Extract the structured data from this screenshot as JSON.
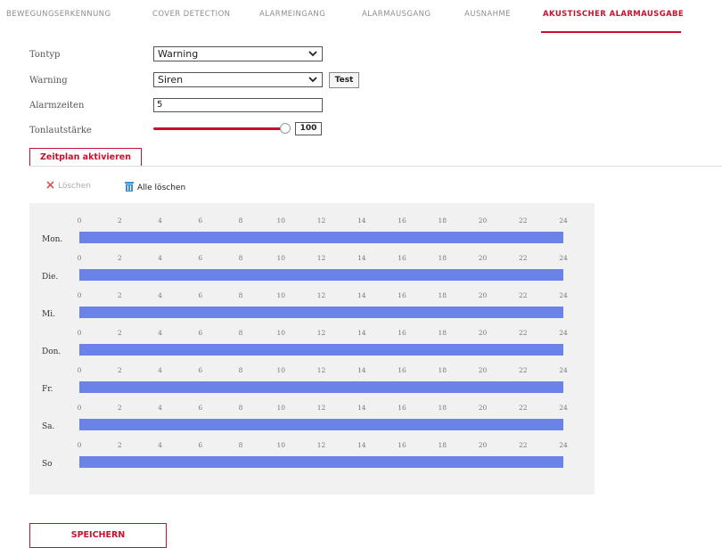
{
  "tabs": [
    {
      "label": "BEWEGUNGSERKENNUNG"
    },
    {
      "label": "COVER DETECTION"
    },
    {
      "label": "ALARMEINGANG"
    },
    {
      "label": "ALARMAUSGANG"
    },
    {
      "label": "AUSNAHME"
    },
    {
      "label": "AKUSTISCHER ALARMAUSGABE"
    }
  ],
  "active_tab": "AKUSTISCHER ALARMAUSGABE",
  "form": {
    "tontyp": {
      "label": "Tontyp",
      "value": "Warning"
    },
    "warning": {
      "label": "Warning",
      "value": "Siren",
      "test_label": "Test"
    },
    "alarmzeiten": {
      "label": "Alarmzeiten",
      "value": "5"
    },
    "tonlautstaerke": {
      "label": "Tonlautstärke",
      "value": "100",
      "level_percent": 100
    }
  },
  "zeitplan_button": "Zeitplan aktivieren",
  "actions": {
    "loeschen": "Löschen",
    "alle_loeschen": "Alle löschen"
  },
  "schedule": {
    "hour_ticks": [
      "0",
      "2",
      "4",
      "6",
      "8",
      "10",
      "12",
      "14",
      "16",
      "18",
      "20",
      "22",
      "24"
    ],
    "days": [
      {
        "label": "Mon.",
        "from": 0,
        "to": 24
      },
      {
        "label": "Die.",
        "from": 0,
        "to": 24
      },
      {
        "label": "Mi.",
        "from": 0,
        "to": 24
      },
      {
        "label": "Don.",
        "from": 0,
        "to": 24
      },
      {
        "label": "Fr.",
        "from": 0,
        "to": 24
      },
      {
        "label": "Sa.",
        "from": 0,
        "to": 24
      },
      {
        "label": "So",
        "from": 0,
        "to": 24
      }
    ]
  },
  "save_button": "SPEICHERN",
  "colors": {
    "accent": "#c8102e",
    "schedule_bar": "#6b82e8",
    "schedule_bg": "#f1f1f1"
  }
}
